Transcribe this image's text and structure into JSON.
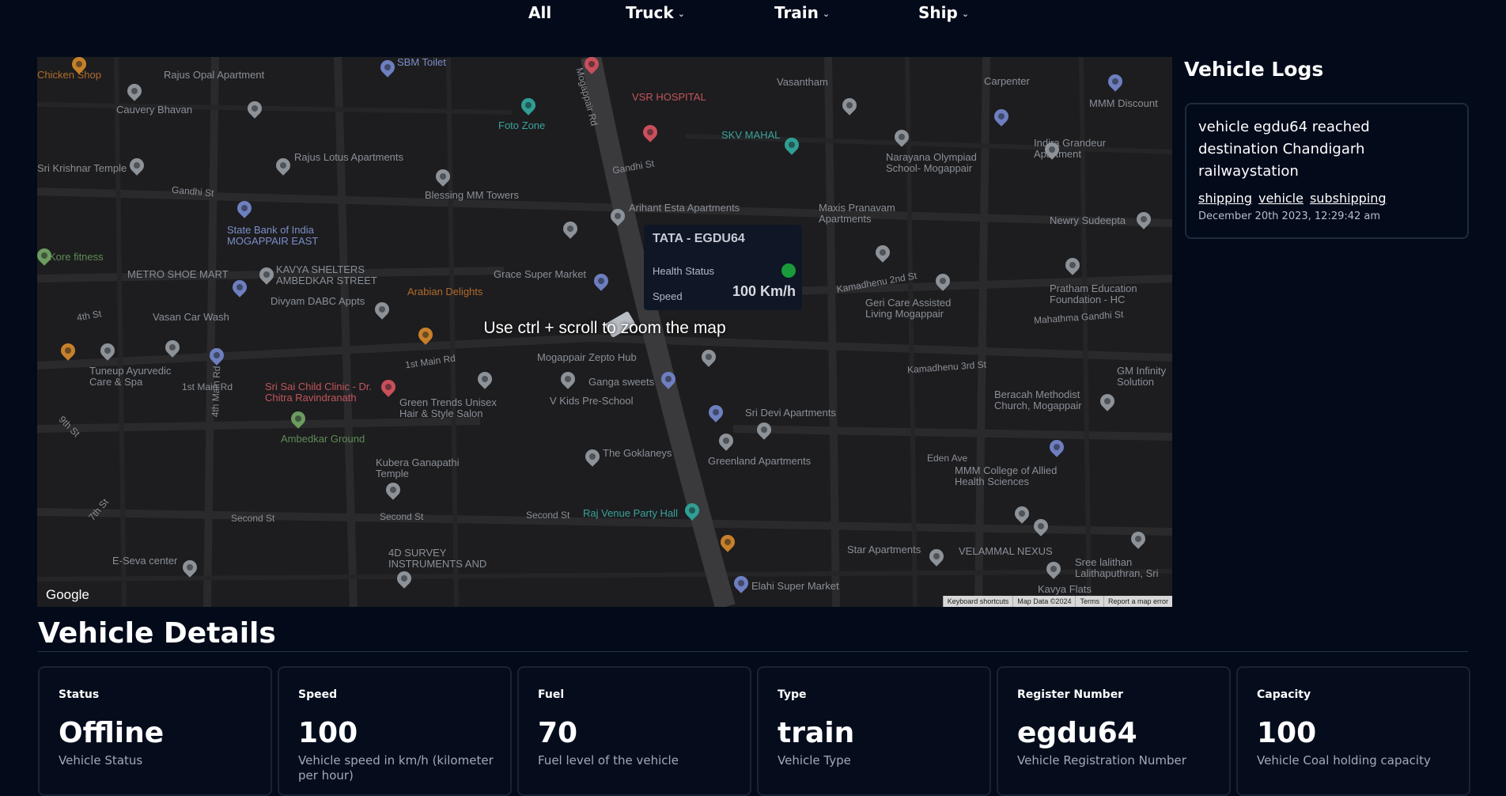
{
  "nav": {
    "all": "All",
    "truck": "Truck",
    "train": "Train",
    "ship": "Ship"
  },
  "map": {
    "overlay": "Use ctrl + scroll to zoom the map",
    "google": "Google",
    "attribution": [
      "Keyboard shortcuts",
      "Map Data ©2024",
      "Terms",
      "Report a map error"
    ],
    "tooltip": {
      "title": "TATA - EGDU64",
      "health_label": "Health Status",
      "speed_label": "Speed",
      "speed_value": "100 Km/h"
    },
    "streets": [
      "Mogappair Rd",
      "Gandhi St",
      "Gandhi St",
      "4th St",
      "1st Main Rd",
      "1st Main Rd",
      "4th Main Rd",
      "9th St",
      "7th St",
      "Second St",
      "Second St",
      "Second St",
      "Kamadhenu 2nd St",
      "Kamadhenu 3rd St",
      "Mahathma Gandhi St",
      "Eden Ave"
    ],
    "places": [
      "Chicken Shop",
      "Rajus Opal Apartment",
      "SBM Toilet",
      "VSR HOSPITAL",
      "Vasantham",
      "Carpenter",
      "MMM Discount",
      "Cauvery Bhavan",
      "Foto Zone",
      "SKV MAHAL",
      "Indira Grandeur Apartment",
      "Sri Krishnar Temple",
      "Rajus Lotus Apartments",
      "Narayana Olympiad School- Mogappair",
      "Blessing MM Towers",
      "State Bank of India MOGAPPAIR EAST",
      "Arihant Esta Apartments",
      "Maxis Pranavam Apartments",
      "Newry Sudeepta",
      "Kore fitness",
      "KAVYA SHELTERS AMBEDKAR STREET",
      "Grace Super Market",
      "METRO SHOE MART",
      "Divyam DABC Appts",
      "Arabian Delights",
      "Pratham Education Foundation - HC",
      "Geri Care Assisted Living Mogappair",
      "Vasan Car Wash",
      "Mogappair Zepto Hub",
      "Tuneup Ayurvedic Care & Spa",
      "Ganga sweets",
      "Sri Sai Child Clinic - Dr. Chitra Ravindranath",
      "Green Trends Unisex Hair & Style Salon",
      "V Kids Pre-School",
      "Beracah Methodist Church, Mogappair",
      "GM Infinity Solution",
      "Sri Devi Apartments",
      "Ambedkar Ground",
      "The Goklaneys",
      "Greenland Apartments",
      "Kubera Ganapathi Temple",
      "MMM College of Allied Health Sciences",
      "Raj Venue Party Hall",
      "4D SURVEY INSTRUMENTS AND",
      "E-Seva center",
      "Star Apartments",
      "VELAMMAL NEXUS",
      "Sree lalithan Lalithaputhran, Sri",
      "Elahi Super Market",
      "Kavya Flats"
    ]
  },
  "logs": {
    "title": "Vehicle Logs",
    "entries": [
      {
        "message": "vehicle egdu64 reached destination Chandigarh railwaystation",
        "tags": [
          "shipping",
          "vehicle",
          "subshipping"
        ],
        "time": "December 20th 2023, 12:29:42 am"
      }
    ]
  },
  "details": {
    "title": "Vehicle Details",
    "cards": [
      {
        "label": "Status",
        "value": "Offline",
        "desc": "Vehicle Status"
      },
      {
        "label": "Speed",
        "value": "100",
        "desc": "Vehicle speed in km/h (kilometer per hour)"
      },
      {
        "label": "Fuel",
        "value": "70",
        "desc": "Fuel level of the vehicle"
      },
      {
        "label": "Type",
        "value": "train",
        "desc": "Vehicle Type"
      },
      {
        "label": "Register Number",
        "value": "egdu64",
        "desc": "Vehicle Registration Number"
      },
      {
        "label": "Capacity",
        "value": "100",
        "desc": "Vehicle Coal holding capacity"
      }
    ]
  },
  "colors": {
    "background": "#030a1a",
    "map_bg": "#1d1d1f",
    "health_ok": "#1a9a3a"
  }
}
